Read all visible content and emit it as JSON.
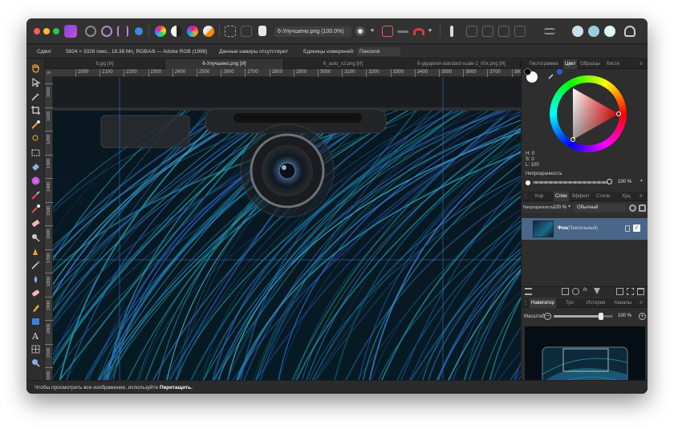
{
  "window": {
    "doc_dropdown": "6-Улучшено.png (100.0%)"
  },
  "context_bar": {
    "tool_name": "Сдвиг",
    "image_info": "5824 × 3328 пикс., 19.38 Мп, RGBA/8 — Adobe RGB (1998)",
    "camera_info": "Данные камеры отсутствуют",
    "units_label": "Единицы измерений:",
    "units_value": "Пиксели"
  },
  "doc_tabs": [
    {
      "label": "6.jpg [И]",
      "active": false
    },
    {
      "label": "6-Улучшено.png [И]",
      "active": true
    },
    {
      "label": "6_auto_x2.png [И]",
      "active": false
    },
    {
      "label": "6-gigapixel-standard-scale-2_00x.png [И]",
      "active": false
    }
  ],
  "ruler": {
    "unit": "px",
    "h_ticks": [
      "2000",
      "2100",
      "2200",
      "2300",
      "2400",
      "2500",
      "2600",
      "2700",
      "2800",
      "2900",
      "3000",
      "3100",
      "3200",
      "3300",
      "3400",
      "3500",
      "3600",
      "3700",
      "3800"
    ],
    "v_ticks": [
      "1000",
      "1100",
      "1200",
      "1300",
      "1400",
      "1500",
      "1600",
      "1700",
      "1800",
      "1900",
      "2000",
      "2100",
      "2200"
    ]
  },
  "color_panel": {
    "tabs": [
      "Гистограмма",
      "Цвет",
      "Образцы",
      "Кисти"
    ],
    "active_tab": "Цвет",
    "h": "H: 0",
    "s": "S: 0",
    "l": "L: 100",
    "opacity_label": "Непрозрачность",
    "opacity_value": "100 %"
  },
  "layers_panel": {
    "tabs": [
      "Кор",
      "Слои",
      "Эффект",
      "Стили",
      "Хрц"
    ],
    "active_tab": "Слои",
    "opacity_label": "Непрозрачность",
    "opacity_value": "100 %",
    "blend_mode": "Обычный",
    "layer_name": "Фон",
    "layer_type": "(Пиксельный)"
  },
  "navigator_panel": {
    "tabs": [
      "Навигатор",
      "Тро",
      "История",
      "Каналы"
    ],
    "active_tab": "Навигатор",
    "scale_label": "Масштаб",
    "scale_value": "100 %",
    "zoom_fraction": 0.8
  },
  "status_bar": {
    "hint": "Чтобы просмотреть все изображение, используйте ",
    "hint_action": "Перетащить."
  }
}
